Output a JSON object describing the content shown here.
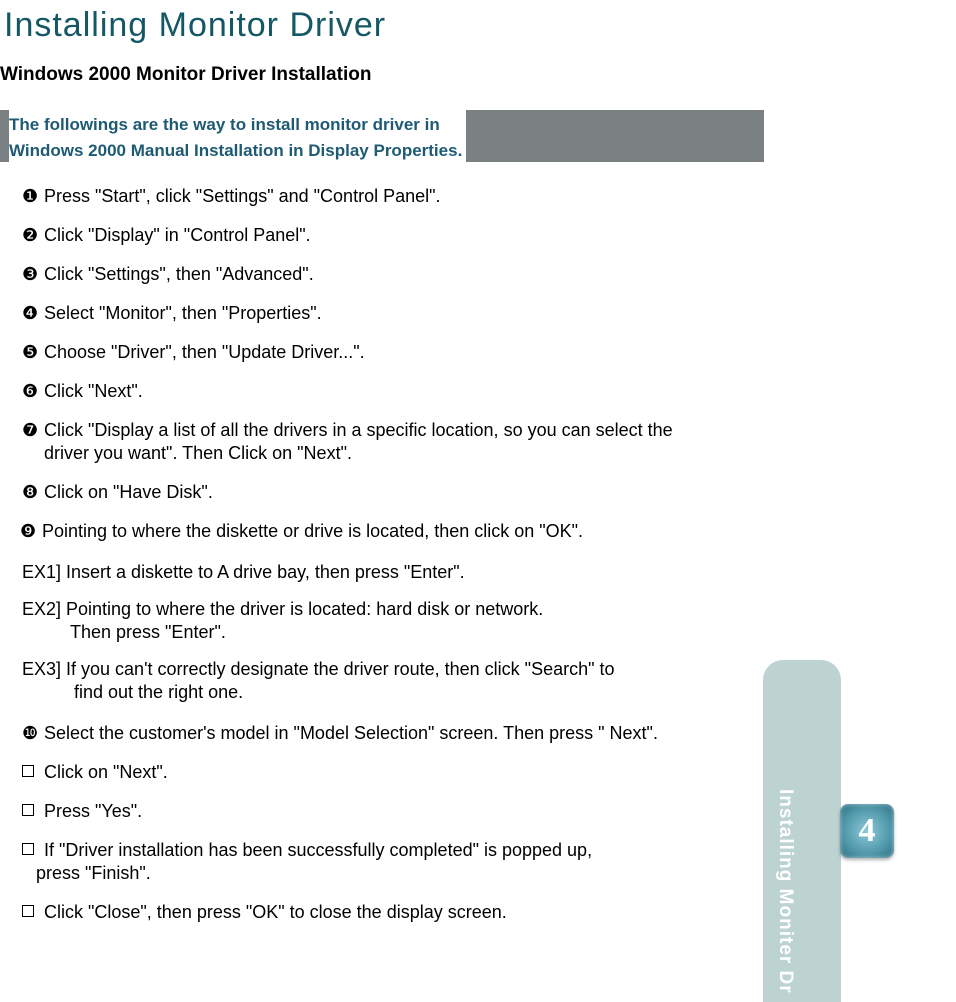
{
  "title": "Installing Monitor Driver",
  "subtitle": "Windows 2000 Monitor Driver Installation",
  "intro_line1": "The followings are the way to install monitor driver in",
  "intro_line2": "Windows 2000 Manual Installation in Display Properties.",
  "steps": {
    "s1": "Press \"Start\", click \"Settings\" and \"Control Panel\".",
    "s2": "Click \"Display\" in \"Control Panel\".",
    "s3": "Click \"Settings\", then \"Advanced\".",
    "s4": "Select \"Monitor\", then \"Properties\".",
    "s5": "Choose \"Driver\", then \"Update Driver...\".",
    "s6": "Click \"Next\".",
    "s7a": "Click \"Display a list of all the drivers  in a specific location, so you can select the",
    "s7b": "driver you want\". Then Click on \"Next\".",
    "s8": "Click on \"Have Disk\".",
    "s9": "Pointing to where the diskette or drive is located, then click on \"OK\".",
    "ex1": "EX1] Insert a diskette to A drive bay, then press \"Enter\".",
    "ex2a": "EX2] Pointing to where the driver is located: hard disk or network.",
    "ex2b": "Then press \"Enter\".",
    "ex3a": "EX3] If you  can't correctly designate the  driver route, then  click \"Search\" to",
    "ex3b": "find out the right one.",
    "s10": "Select the customer's model in \"Model Selection\" screen. Then press \" Next\".",
    "s11": "Click on \"Next\".",
    "s12": "Press \"Yes\".",
    "s13a": "If \"Driver installation  has been successfully  completed\" is popped up,",
    "s13b": "press \"Finish\".",
    "s14": "Click \"Close\", then press \"OK\" to close the display screen."
  },
  "bullets": {
    "b1": "❶",
    "b2": "❷",
    "b3": "❸",
    "b4": "❹",
    "b5": "❺",
    "b6": "❻",
    "b7": "❼",
    "b8": "❽",
    "b9": "❾",
    "b10": "❿"
  },
  "side_tab_label": "Installing Moniter Dr",
  "chapter_number": "4"
}
